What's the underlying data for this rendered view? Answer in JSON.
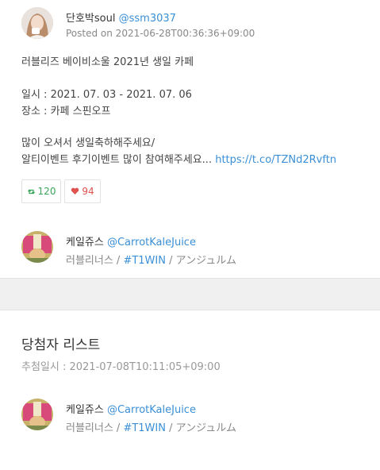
{
  "post": {
    "author_name": "단호박soul",
    "author_handle": "@ssm3037",
    "posted_label": "Posted on 2021-06-28T00:36:36+09:00",
    "lines": [
      "러블리즈 베이비소울 2021년 생일 카페",
      "일시 : 2021. 07. 03 - 2021. 07. 06",
      "장소 : 카페 스핀오프",
      "많이 오셔서 생일축하해주세요/",
      "알티이벤트 후기이벤트 많이 참여해주세요... "
    ],
    "link_text": "https://t.co/TZNd2Rvftn",
    "retweet_count": "120",
    "like_count": "94"
  },
  "entries": [
    {
      "name": "케일쥬스",
      "handle": "@CarrotKaleJuice",
      "tag_prefix": "러블리너스 / ",
      "hashtag": "#T1WIN",
      "tag_suffix": " / アンジュルム"
    },
    {
      "name": "케일쥬스",
      "handle": "@CarrotKaleJuice",
      "tag_prefix": "러블리너스 / ",
      "hashtag": "#T1WIN",
      "tag_suffix": " / アンジュルム"
    }
  ],
  "winners": {
    "title": "당첨자 리스트",
    "draw_time": "추첨일시 : 2021-07-08T10:11:05+09:00"
  },
  "icons": {
    "retweet": "retweet-icon",
    "like": "heart-icon"
  },
  "colors": {
    "link": "#3a8fd6",
    "retweet": "#3aa55a",
    "like": "#e0524e"
  }
}
